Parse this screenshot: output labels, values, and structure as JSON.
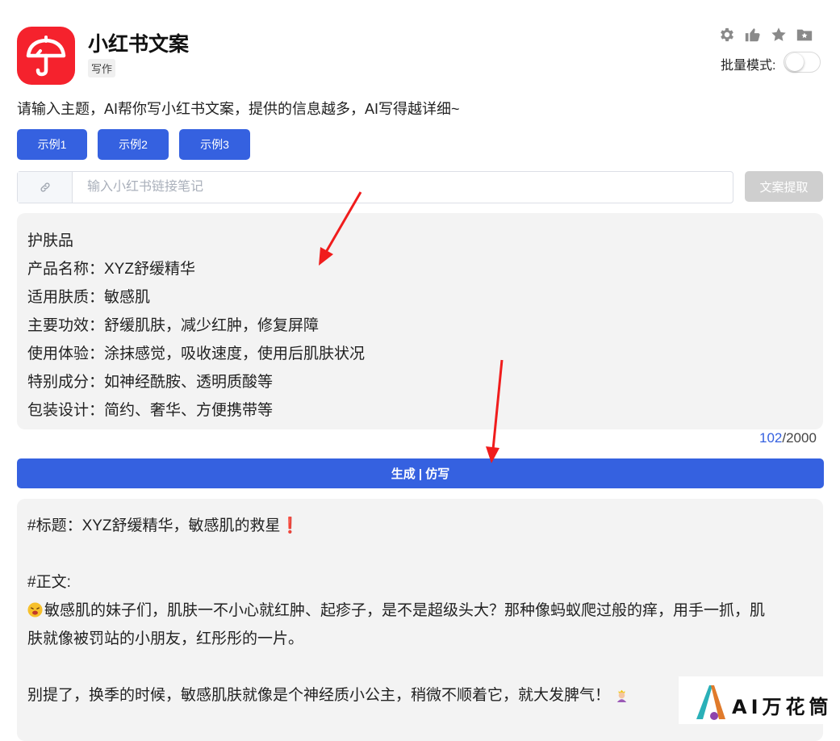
{
  "header": {
    "app_title": "小红书文案",
    "tag": "写作",
    "icons": [
      "gear-icon",
      "thumbs-up-icon",
      "star-icon",
      "folder-star-icon"
    ],
    "batch_mode_label": "批量模式:"
  },
  "description": "请输入主题，AI帮你写小红书文案，提供的信息越多，AI写得越详细~",
  "examples": [
    "示例1",
    "示例2",
    "示例3"
  ],
  "link_input": {
    "placeholder": "输入小红书链接笔记",
    "value": "",
    "extract_label": "文案提取"
  },
  "prompt_lines": [
    "护肤品",
    "产品名称：XYZ舒缓精华",
    "适用肤质：敏感肌",
    "主要功效：舒缓肌肤，减少红肿，修复屏障",
    "使用体验：涂抹感觉，吸收速度，使用后肌肤状况",
    "特别成分：如神经酰胺、透明质酸等",
    "包装设计：简约、奢华、方便携带等"
  ],
  "counter": {
    "current": "102",
    "max": "/2000"
  },
  "generate_label": "生成 | 仿写",
  "output": {
    "title_line": "#标题：XYZ舒缓精华，敏感肌的救星❗",
    "body_heading": "#正文:",
    "para1_line1": "敏感肌的妹子们，肌肤一不小心就红肿、起疹子，是不是超级头大？那种像蚂蚁爬过般的痒，用手一抓，肌",
    "para1_line2": "肤就像被罚站的小朋友，红彤彤的一片。",
    "para2": "别提了，换季的时候，敏感肌肤就像是个神经质小公主，稍微不顺着它，就大发脾气！"
  },
  "colors": {
    "accent": "#3561e0",
    "brand_red": "#f5222d",
    "disabled": "#cfcfcf",
    "panel": "#f3f3f3"
  },
  "watermark": "AI万花筒"
}
